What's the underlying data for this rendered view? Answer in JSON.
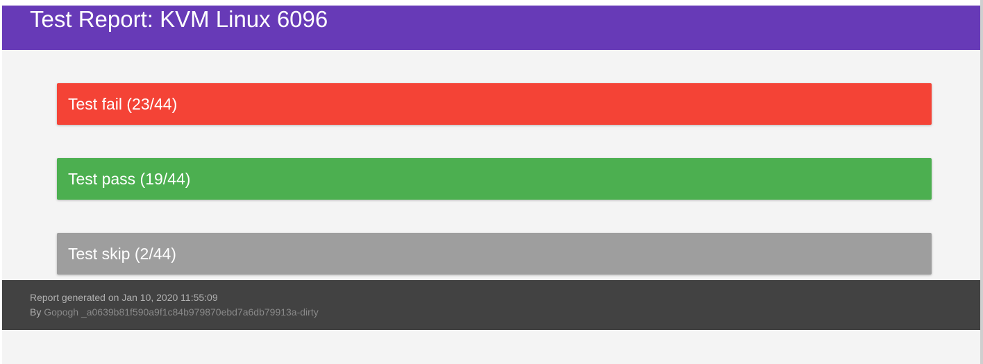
{
  "header": {
    "title": "Test Report: KVM Linux 6096",
    "color": "#673ab7"
  },
  "sections": {
    "fail": {
      "label": "Test fail (23/44)",
      "color": "#f44336"
    },
    "pass": {
      "label": "Test pass (19/44)",
      "color": "#4caf50"
    },
    "skip": {
      "label": "Test skip (2/44)",
      "color": "#9e9e9e"
    }
  },
  "footer": {
    "generated_text": "Report generated on Jan 10, 2020 11:55:09",
    "by_prefix": "By ",
    "author_link": "Gopogh _a0639b81f590a9f1c84b979870ebd7a6db79913a-dirty",
    "color": "#424242"
  }
}
